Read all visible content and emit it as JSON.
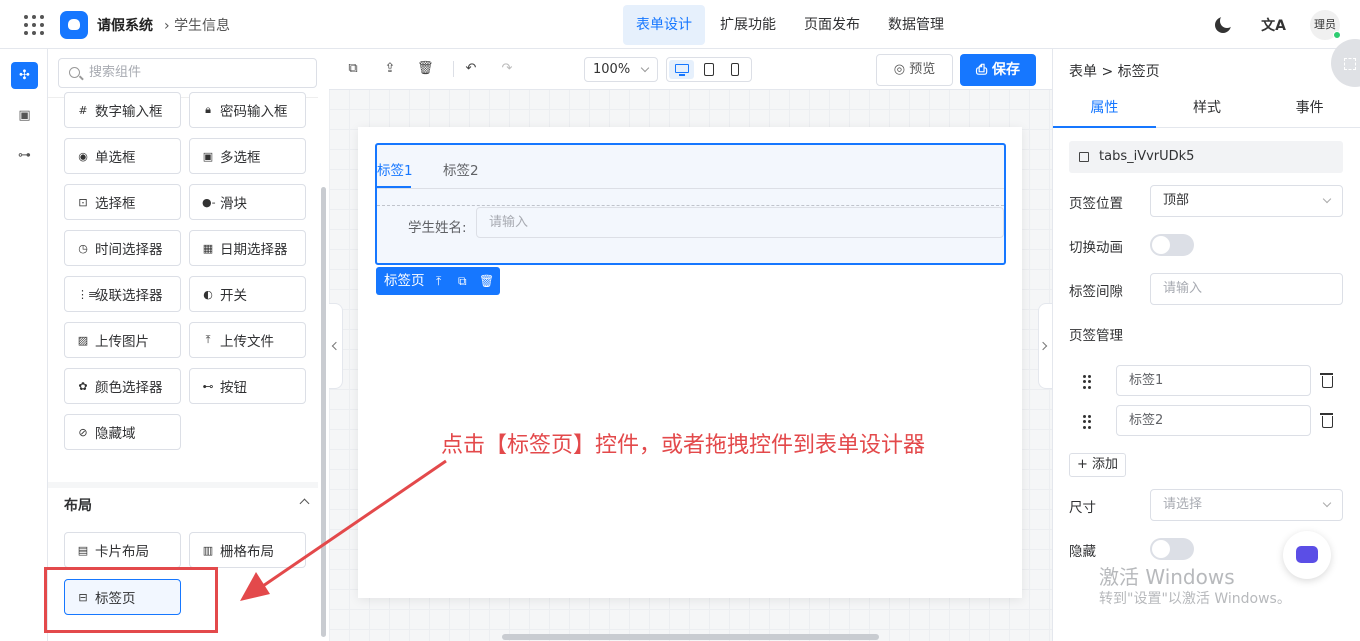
{
  "header": {
    "app_title": "请假系统",
    "breadcrumb": "学生信息",
    "nav": [
      "表单设计",
      "扩展功能",
      "页面发布",
      "数据管理"
    ],
    "active_nav": "表单设计",
    "user": "理员"
  },
  "components": {
    "search_placeholder": "搜索组件",
    "items": [
      {
        "label": "数字输入框",
        "icon": "number-input-icon"
      },
      {
        "label": "密码输入框",
        "icon": "lock-icon"
      },
      {
        "label": "单选框",
        "icon": "radio-icon"
      },
      {
        "label": "多选框",
        "icon": "checkbox-icon"
      },
      {
        "label": "选择框",
        "icon": "select-icon"
      },
      {
        "label": "滑块",
        "icon": "slider-icon"
      },
      {
        "label": "时间选择器",
        "icon": "clock-icon"
      },
      {
        "label": "日期选择器",
        "icon": "calendar-icon"
      },
      {
        "label": "级联选择器",
        "icon": "cascader-icon"
      },
      {
        "label": "开关",
        "icon": "switch-icon"
      },
      {
        "label": "上传图片",
        "icon": "image-icon"
      },
      {
        "label": "上传文件",
        "icon": "upload-icon"
      },
      {
        "label": "颜色选择器",
        "icon": "palette-icon"
      },
      {
        "label": "按钮",
        "icon": "button-icon"
      },
      {
        "label": "隐藏域",
        "icon": "eye-off-icon"
      }
    ],
    "layout_section": "布局",
    "layout_items": [
      {
        "label": "卡片布局",
        "icon": "card-icon"
      },
      {
        "label": "栅格布局",
        "icon": "grid-layout-icon"
      },
      {
        "label": "标签页",
        "icon": "tabs-icon"
      }
    ]
  },
  "toolbar": {
    "zoom": "100%",
    "preview": "预览",
    "save": "保存"
  },
  "canvas": {
    "tabs": [
      "标签1",
      "标签2"
    ],
    "field_label": "学生姓名:",
    "field_placeholder": "请输入",
    "selected_tag": "标签页"
  },
  "annotation": {
    "text": "点击【标签页】控件，或者拖拽控件到表单设计器",
    "color": "#e3494b"
  },
  "props": {
    "breadcrumb": "表单 > 标签页",
    "tabs": [
      "属性",
      "样式",
      "事件"
    ],
    "component_id": "tabs_iVvrUDk5",
    "position_label": "页签位置",
    "position_value": "顶部",
    "animation_label": "切换动画",
    "gap_label": "标签间隙",
    "gap_placeholder": "请输入",
    "manage_label": "页签管理",
    "tab_items": [
      "标签1",
      "标签2"
    ],
    "add_button": "+ 添加",
    "size_label": "尺寸",
    "size_placeholder": "请选择",
    "hidden_label": "隐藏"
  },
  "watermark": {
    "line1": "激活 Windows",
    "line2": "转到\"设置\"以激活 Windows。"
  },
  "colors": {
    "primary": "#1677ff",
    "annotation": "#e3494b"
  }
}
